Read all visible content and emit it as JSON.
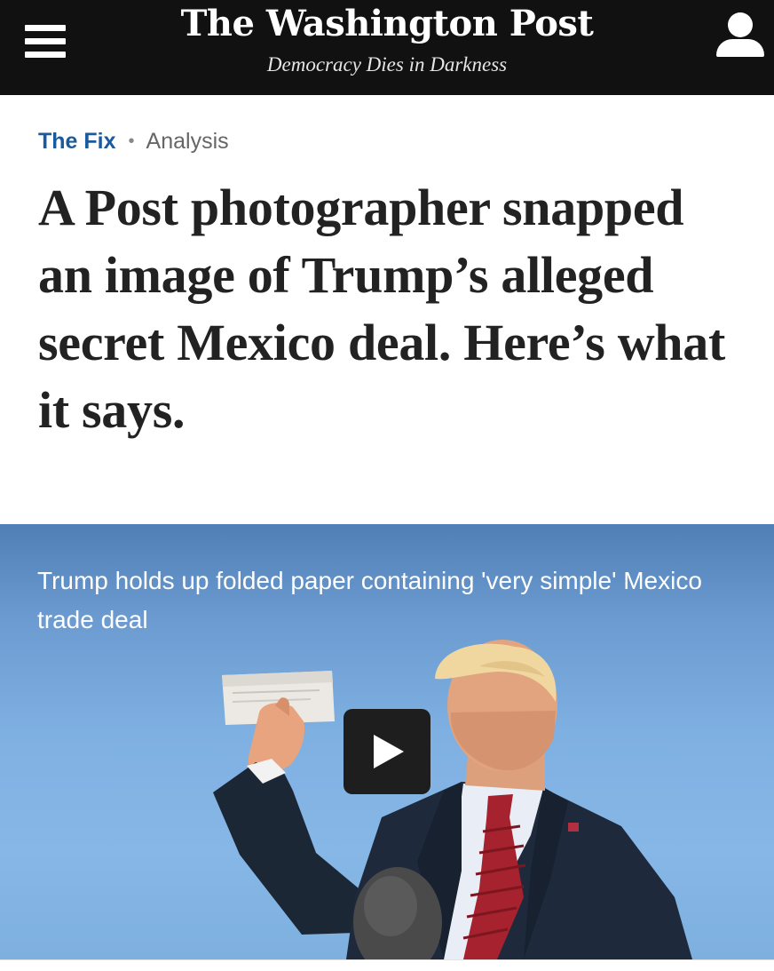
{
  "header": {
    "logo": "The Washington Post",
    "tagline": "Democracy Dies in Darkness",
    "menu_icon": "hamburger-menu-icon",
    "account_icon": "user-account-icon",
    "background": "#111111"
  },
  "article": {
    "section": "The Fix",
    "separator": "•",
    "label": "Analysis",
    "headline": "A Post photographer snapped an image of Trump’s alleged secret Mexico deal. Here’s what it says.",
    "section_color": "#1a5a9e"
  },
  "video": {
    "caption": "Trump holds up folded paper containing 'very simple' Mexico trade deal",
    "play_icon": "play-icon"
  }
}
